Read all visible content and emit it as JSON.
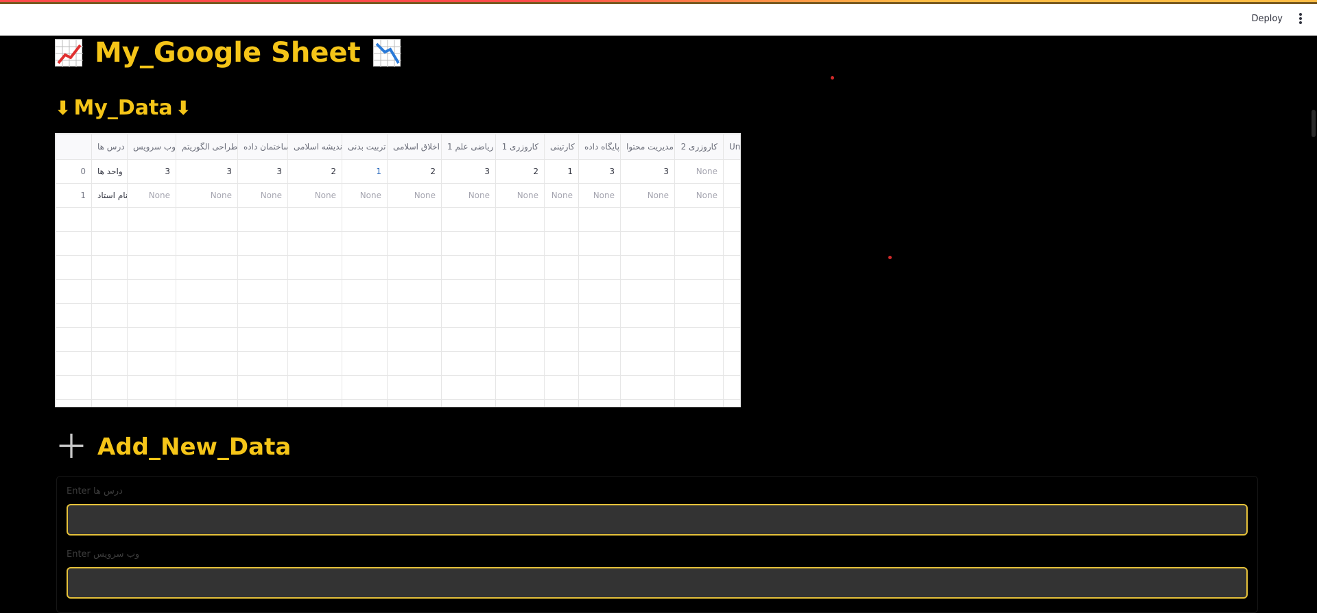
{
  "header": {
    "deploy_label": "Deploy",
    "menu_icon": "kebab-menu-icon"
  },
  "title": {
    "text": "My_Google Sheet",
    "left_icon": "chart-increasing-icon",
    "right_icon": "chart-decreasing-icon"
  },
  "data_section": {
    "title": "My_Data",
    "icon": "arrow-down-icon"
  },
  "table": {
    "columns": [
      "",
      "درس ها",
      "وب سرویس",
      "طراحی الگوریتم",
      "ساختمان داده",
      "اندیشه اسلامی",
      "تربیت بدنی",
      "اخلاق اسلامی",
      "ریاضی علم 1",
      "کاروزری 1",
      "کارتینی",
      "پایگاه داده",
      "مدیریت محتوا",
      "کاروزری 2",
      "Unn"
    ],
    "rows": [
      [
        "0",
        "واحد ها",
        "3",
        "3",
        "3",
        "2",
        "1",
        "2",
        "3",
        "2",
        "1",
        "3",
        "3",
        "None",
        ""
      ],
      [
        "1",
        "نام استاد",
        "None",
        "None",
        "None",
        "None",
        "None",
        "None",
        "None",
        "None",
        "None",
        "None",
        "None",
        "None",
        ""
      ]
    ],
    "empty_rows": 9
  },
  "add_section": {
    "title": "Add_New_Data",
    "icon": "plus-icon"
  },
  "form": {
    "field1_label": "Enter درس ها",
    "field1_value": "",
    "field2_label": "Enter وب سرویس",
    "field2_value": ""
  },
  "colors": {
    "accent": "#f5c518",
    "background": "#000000",
    "input_border": "#e6c23a"
  }
}
